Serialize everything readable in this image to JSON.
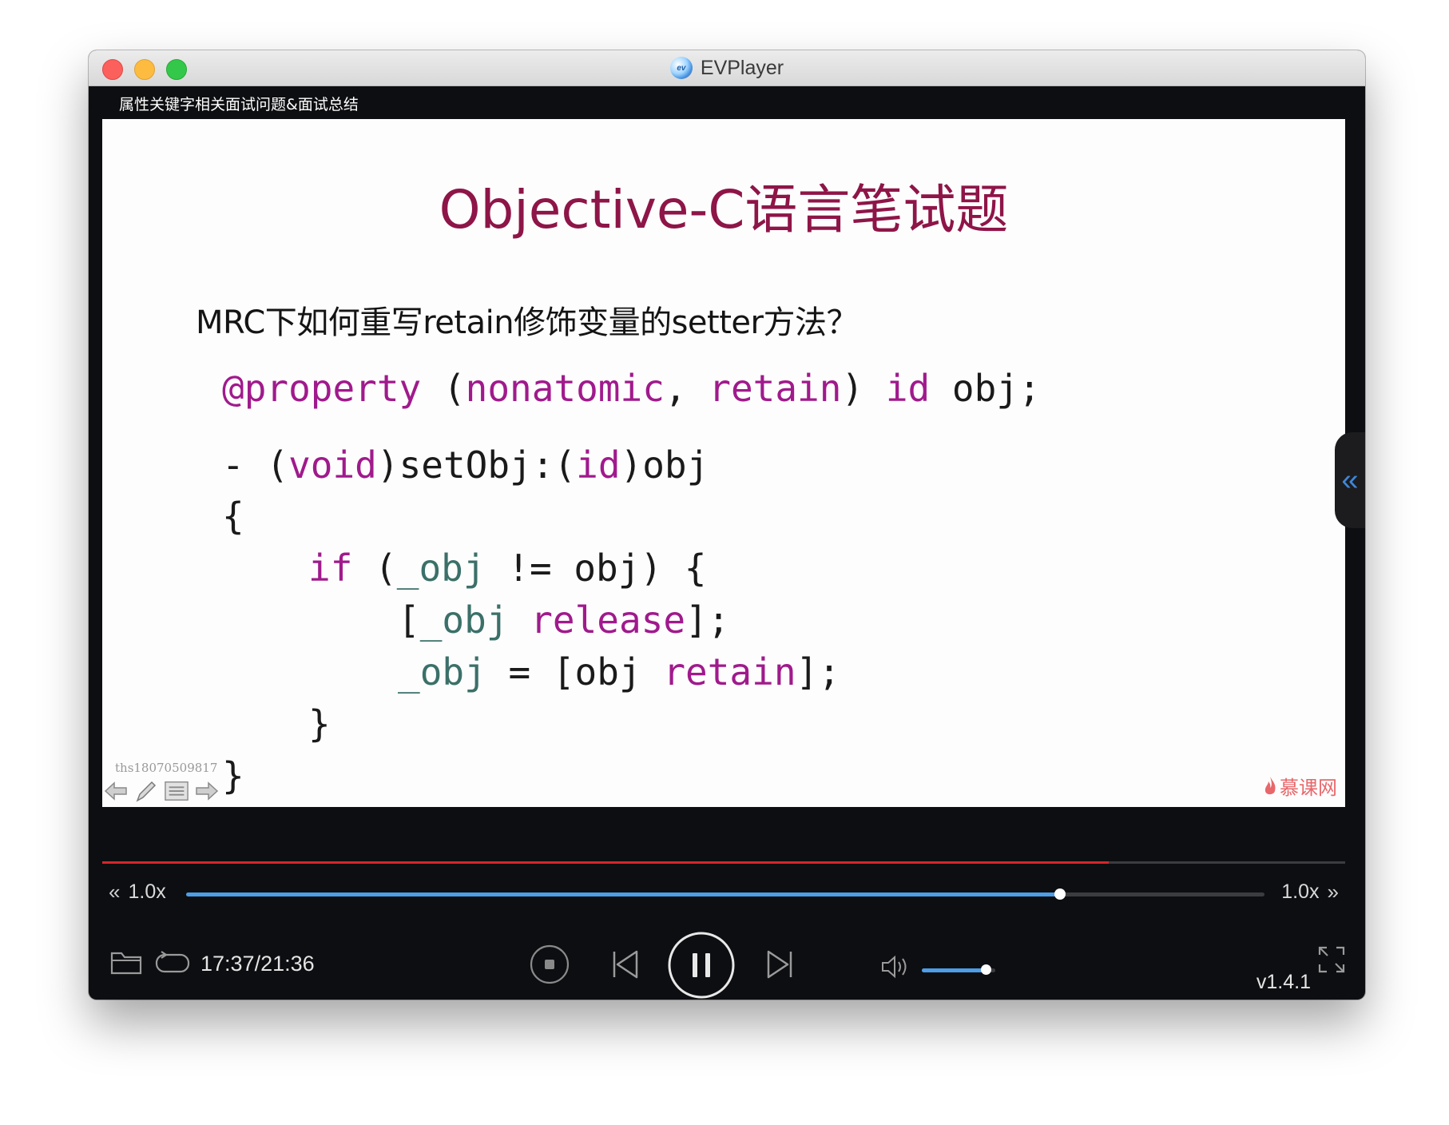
{
  "window": {
    "app_title": "EVPlayer",
    "app_icon": "evplayer-logo-icon",
    "video_title": "属性关键字相关面试问题&面试总结"
  },
  "slide": {
    "title": "Objective-C语言笔试题",
    "question": "MRC下如何重写retain修饰变量的setter方法？",
    "code": {
      "property": [
        "@property",
        " (",
        "nonatomic",
        ", ",
        "retain",
        ") ",
        "id",
        " obj;"
      ],
      "signature": [
        "- (",
        "void",
        ")setObj:(",
        "id",
        ")obj"
      ],
      "open_brace": "{",
      "if_line": [
        "if",
        " (",
        "_obj",
        " != obj) {"
      ],
      "release_line": [
        "[",
        "_obj",
        " ",
        "release",
        "];"
      ],
      "assign_line": [
        "_obj",
        " = [obj ",
        "retain",
        "];"
      ],
      "inner_close": "}",
      "outer_close": "}"
    },
    "watermark_id": "ths18070509817",
    "brand": "慕课网",
    "tools": [
      "arrow-left-icon",
      "pen-icon",
      "list-icon",
      "arrow-right-icon"
    ]
  },
  "playback": {
    "progress": 0.81,
    "speed_left": "1.0x",
    "speed_right": "1.0x",
    "speed_level": 0.81,
    "current_time": "17:37",
    "total_time": "21:36",
    "time_display": "17:37/21:36",
    "volume_level": 0.88,
    "version": "v1.4.1"
  },
  "colors": {
    "slide_title": "#8e1548",
    "keyword": "#a01a8c",
    "ivar": "#3b7069",
    "progress": "#d6262b",
    "accent_blue": "#4d9ee6"
  }
}
